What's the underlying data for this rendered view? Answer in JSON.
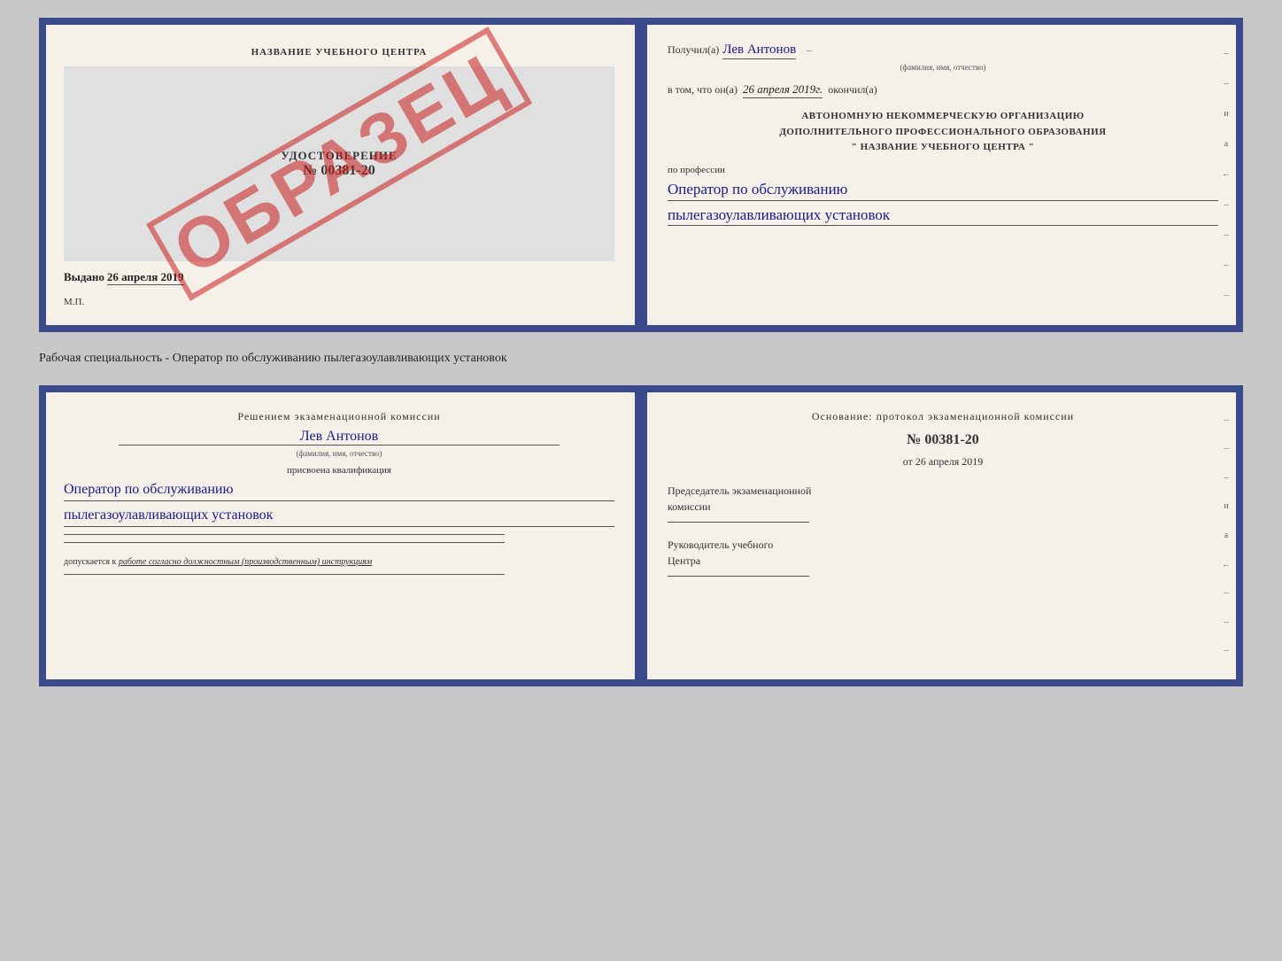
{
  "page": {
    "background": "#c8c8c8"
  },
  "top_doc": {
    "left": {
      "title": "НАЗВАНИЕ УЧЕБНОГО ЦЕНТРА",
      "udostoverenie_label": "УДОСТОВЕРЕНИЕ",
      "number": "№ 00381-20",
      "vydano_label": "Выдано",
      "vydano_date": "26 апреля 2019",
      "mp_label": "М.П.",
      "obrazets": "ОБРАЗЕЦ"
    },
    "right": {
      "poluchil_prefix": "Получил(а)",
      "fio": "Лев Антонов",
      "fio_sub": "(фамилия, имя, отчество)",
      "vtom_prefix": "в том, что он(а)",
      "vtom_date": "26 апреля 2019г.",
      "okochil_label": "окончил(а)",
      "org_line1": "АВТОНОМНУЮ НЕКОММЕРЧЕСКУЮ ОРГАНИЗАЦИЮ",
      "org_line2": "ДОПОЛНИТЕЛЬНОГО ПРОФЕССИОНАЛЬНОГО ОБРАЗОВАНИЯ",
      "org_line3": "\"   НАЗВАНИЕ УЧЕБНОГО ЦЕНТРА   \"",
      "po_professii": "по профессии",
      "profession_line1": "Оператор по обслуживанию",
      "profession_line2": "пылегазоулавливающих установок"
    }
  },
  "separator": {
    "text": "Рабочая специальность - Оператор по обслуживанию пылегазоулавливающих установок"
  },
  "bottom_doc": {
    "left": {
      "resheniem": "Решением экзаменационной комиссии",
      "fio": "Лев Антонов",
      "fio_sub": "(фамилия, имя, отчество)",
      "prisvoena": "присвоена квалификация",
      "qualification_line1": "Оператор по обслуживанию",
      "qualification_line2": "пылегазоулавливающих установок",
      "dopusk_prefix": "допускается к",
      "dopusk_italic": "работе согласно должностным (производственным) инструкциям"
    },
    "right": {
      "osnovanie": "Основание: протокол экзаменационной комиссии",
      "protocol_number": "№ 00381-20",
      "ot_prefix": "от",
      "ot_date": "26 апреля 2019",
      "predsedatel_line1": "Председатель экзаменационной",
      "predsedatel_line2": "комиссии",
      "rukovoditel_line1": "Руководитель учебного",
      "rukovoditel_line2": "Центра"
    }
  }
}
